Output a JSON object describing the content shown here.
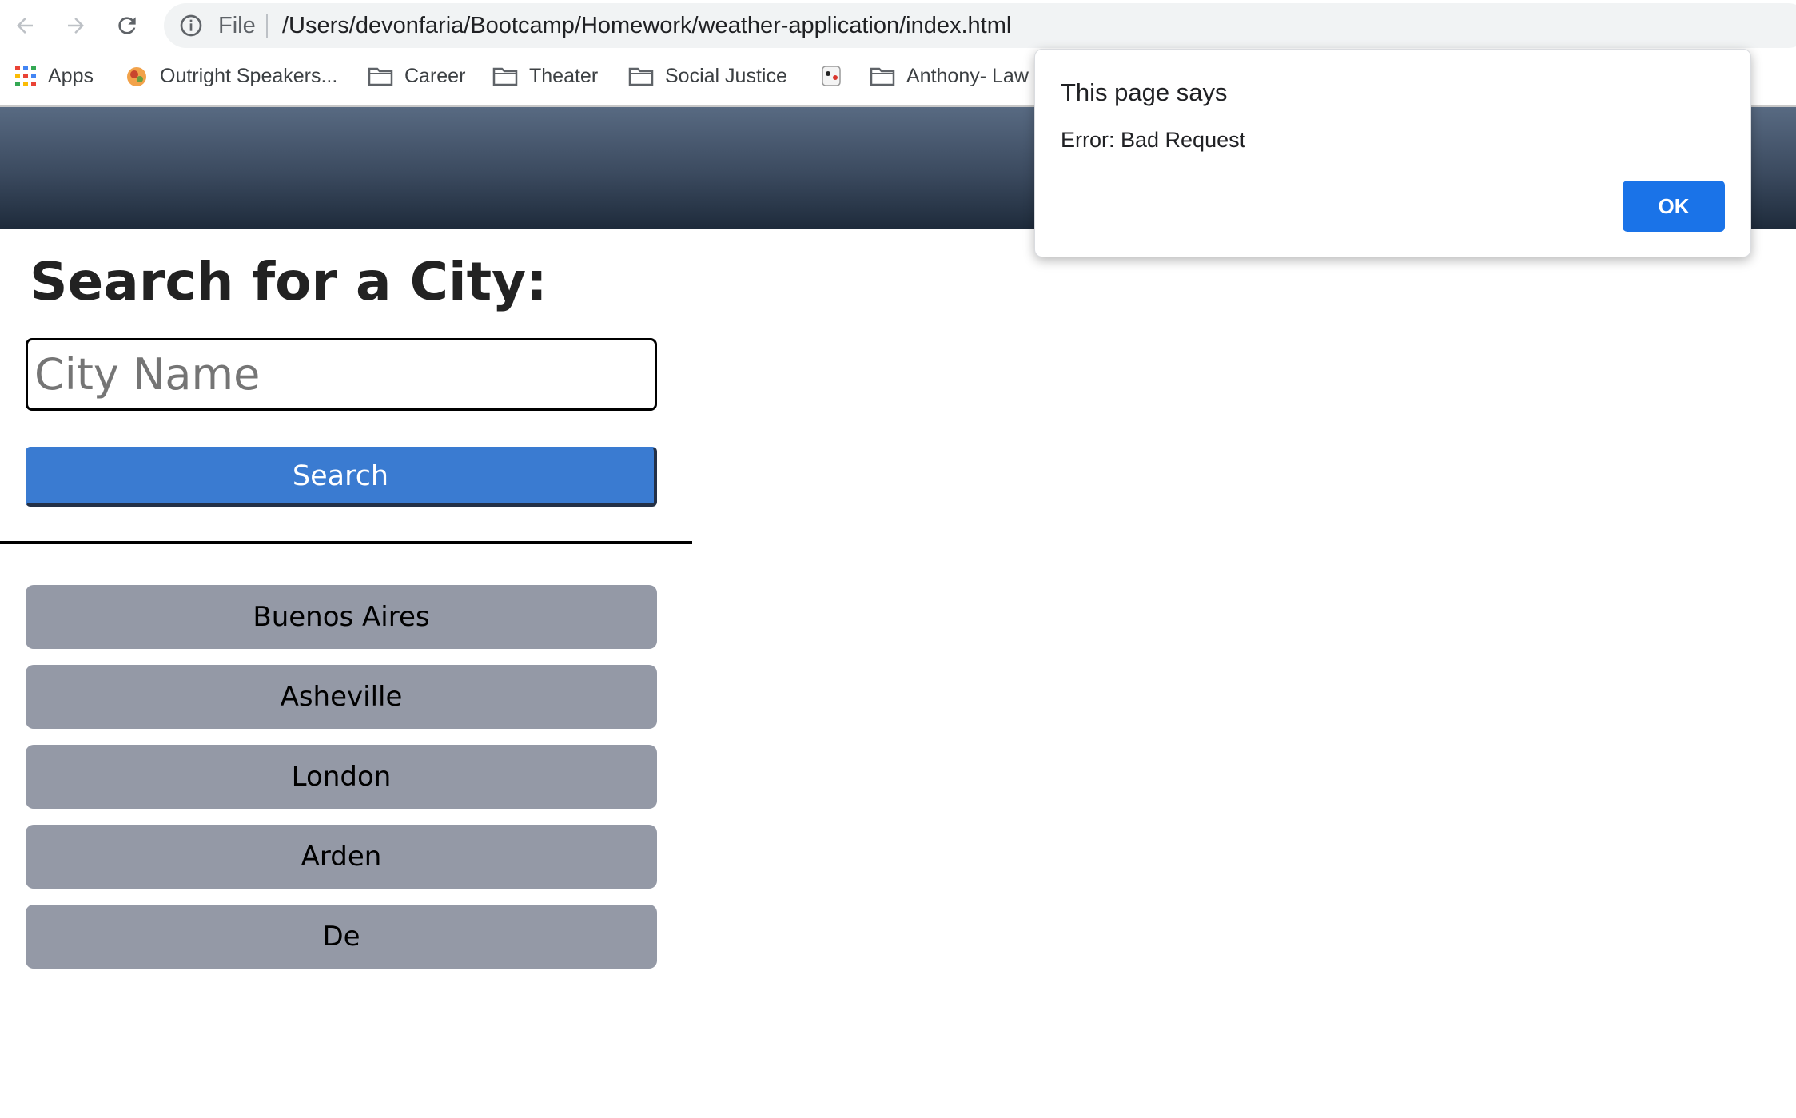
{
  "browser": {
    "address_scheme": "File",
    "url": "/Users/devonfaria/Bootcamp/Homework/weather-application/index.html",
    "bookmarks": [
      {
        "label": "Apps",
        "icon": "apps-grid-icon"
      },
      {
        "label": "Outright Speakers...",
        "icon": "site-favicon"
      },
      {
        "label": "Career",
        "icon": "folder-icon"
      },
      {
        "label": "Theater",
        "icon": "folder-icon"
      },
      {
        "label": "Social Justice",
        "icon": "folder-icon"
      },
      {
        "label": "",
        "icon": "site-favicon"
      },
      {
        "label": "Anthony- Law",
        "icon": "folder-icon"
      }
    ]
  },
  "page": {
    "title": "Search for a City:",
    "search_placeholder": "City Name",
    "search_button": "Search",
    "history": [
      "Buenos Aires",
      "Asheville",
      "London",
      "Arden",
      "De"
    ],
    "colors": {
      "header_gradient_top": "#586a82",
      "header_gradient_bottom": "#1e2b3b",
      "search_button": "#3a7bd1",
      "history_button": "#9499a6"
    }
  },
  "dialog": {
    "title": "This page says",
    "message": "Error: Bad Request",
    "ok_label": "OK",
    "ok_color": "#1a73e8"
  }
}
